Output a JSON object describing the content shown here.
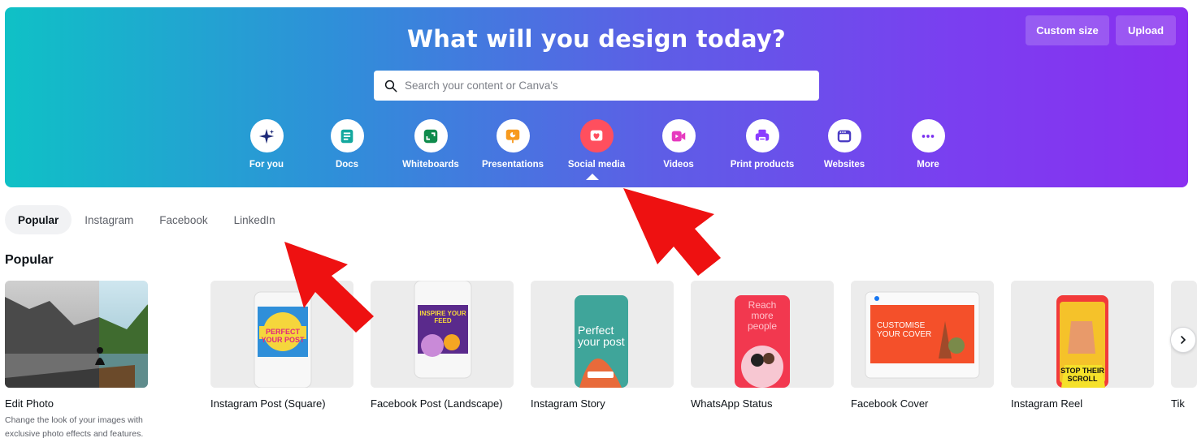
{
  "hero": {
    "title": "What will you design today?",
    "custom_size_label": "Custom size",
    "upload_label": "Upload",
    "search_placeholder": "Search your content or Canva's"
  },
  "categories": [
    {
      "label": "For you",
      "icon": "sparkle-icon",
      "color": "#1e2a78"
    },
    {
      "label": "Docs",
      "icon": "doc-icon",
      "color": "#13a89e"
    },
    {
      "label": "Whiteboards",
      "icon": "whiteboard-icon",
      "color": "#0f8b4c"
    },
    {
      "label": "Presentations",
      "icon": "presentation-icon",
      "color": "#f79a1e"
    },
    {
      "label": "Social media",
      "icon": "heart-icon",
      "color": "#ff4f5e"
    },
    {
      "label": "Videos",
      "icon": "video-icon",
      "color": "#e63abf"
    },
    {
      "label": "Print products",
      "icon": "printer-icon",
      "color": "#8b3dff"
    },
    {
      "label": "Websites",
      "icon": "website-icon",
      "color": "#4b3cc4"
    },
    {
      "label": "More",
      "icon": "more-icon",
      "color": "#7a2ff0"
    }
  ],
  "tabs": [
    "Popular",
    "Instagram",
    "Facebook",
    "LinkedIn"
  ],
  "section_title": "Popular",
  "cards": [
    {
      "title": "Edit Photo",
      "desc": "Change the look of your images with exclusive photo effects and features."
    },
    {
      "title": "Instagram Post (Square)",
      "thumb_text": "PERFECT YOUR POST"
    },
    {
      "title": "Facebook Post (Landscape)",
      "thumb_text": "INSPIRE YOUR FEED"
    },
    {
      "title": "Instagram Story",
      "thumb_text": "Perfect your post"
    },
    {
      "title": "WhatsApp Status",
      "thumb_text": "Reach more people"
    },
    {
      "title": "Facebook Cover",
      "thumb_text": "CUSTOMISE YOUR COVER"
    },
    {
      "title": "Instagram Reel",
      "thumb_text": "STOP THEIR SCROLL"
    },
    {
      "title": "Tik"
    }
  ],
  "colors": {
    "accent_red": "#ee1111",
    "gradient_start": "#0fc1c6",
    "gradient_end": "#8a2ff0"
  }
}
